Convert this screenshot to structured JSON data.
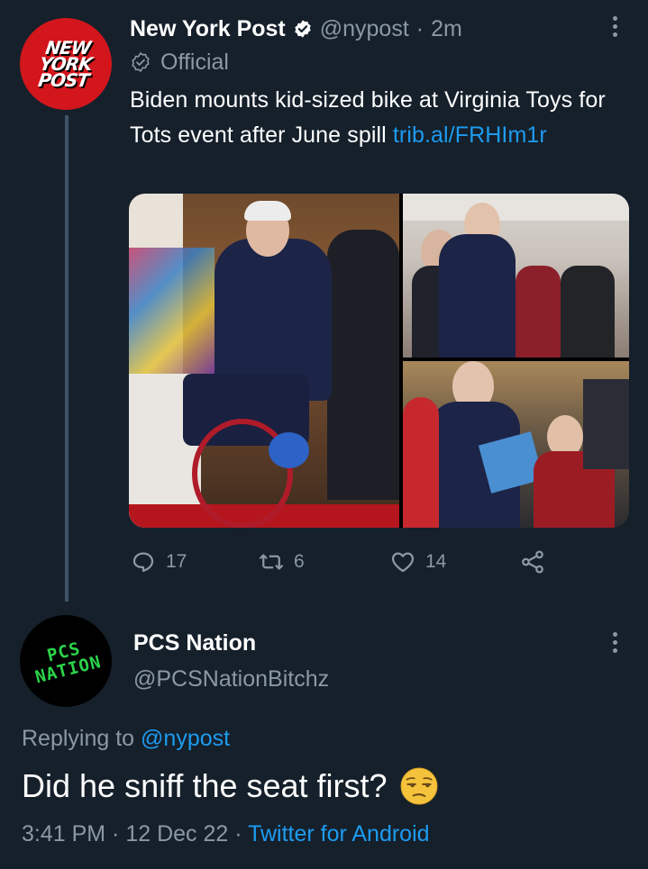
{
  "tweet1": {
    "avatar_text": [
      "NEW",
      "YORK",
      "POST"
    ],
    "name": "New York Post",
    "handle": "@nypost",
    "separator": "·",
    "time": "2m",
    "official_label": "Official",
    "text": "Biden mounts kid-sized bike at Virginia Toys for Tots event after June spill ",
    "link": "trib.al/FRHIm1r",
    "icons": [
      "verified-badge-icon",
      "official-check-icon",
      "more-icon"
    ],
    "actions": {
      "replies": "17",
      "retweets": "6",
      "likes": "14",
      "share_icon": "share-icon"
    }
  },
  "tweet2": {
    "avatar_text": [
      "PCS",
      "NATION"
    ],
    "name": "PCS Nation",
    "handle": "@PCSNationBitchz",
    "replying_label": "Replying to ",
    "replying_handle": "@nypost",
    "text": "Did he sniff the seat first?",
    "emoji": "unamused-face-emoji",
    "time": "3:41 PM",
    "sep": " · ",
    "date": "12 Dec 22",
    "client": "Twitter for Android"
  },
  "colors": {
    "background": "#15202b",
    "text": "#ffffff",
    "muted": "#8b98a5",
    "link": "#1d9bf0",
    "nyp_red": "#d2161c",
    "pcs_green": "#2bd34a"
  }
}
